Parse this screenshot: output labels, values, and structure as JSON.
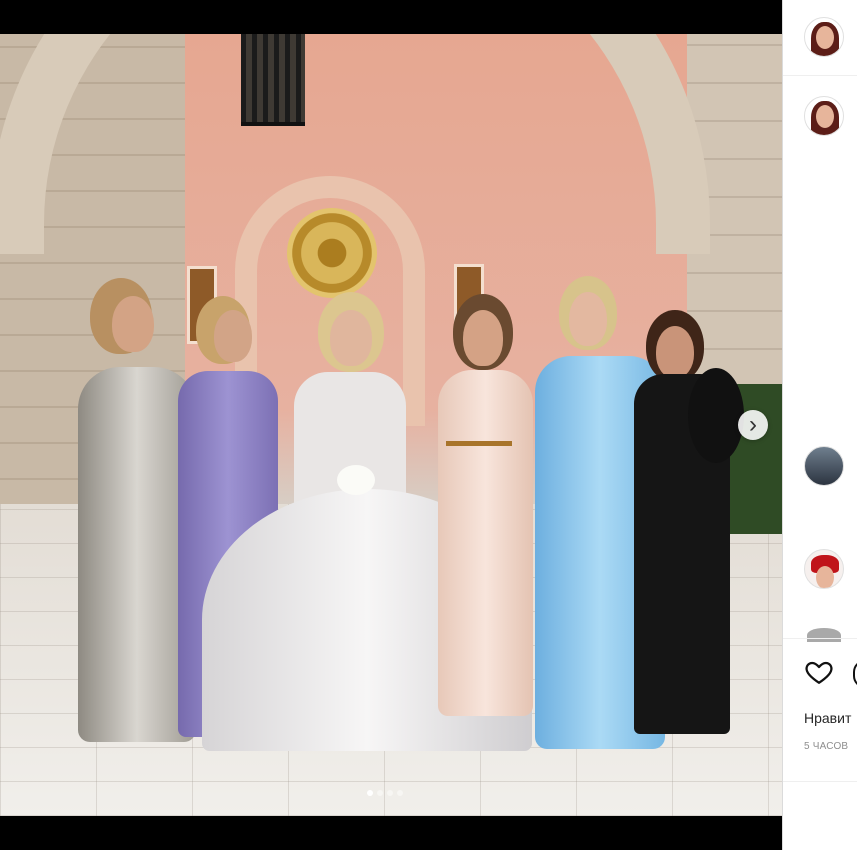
{
  "post": {
    "photo_alt": "",
    "carousel": {
      "total": 4,
      "current": 1,
      "next_glyph": "›"
    }
  },
  "sidebar": {
    "like_icon": "heart-outline-icon",
    "likes_text": "Нравит",
    "timestamp": "5 ЧАСОВ"
  },
  "colors": {
    "pink_wall": "#e6a791",
    "stone": "#d8cbb9",
    "lilac_gown": "#8f83c5",
    "blush_gown": "#f1d3c3",
    "blue_gown": "#8fc5ea",
    "black_dress": "#151515"
  }
}
